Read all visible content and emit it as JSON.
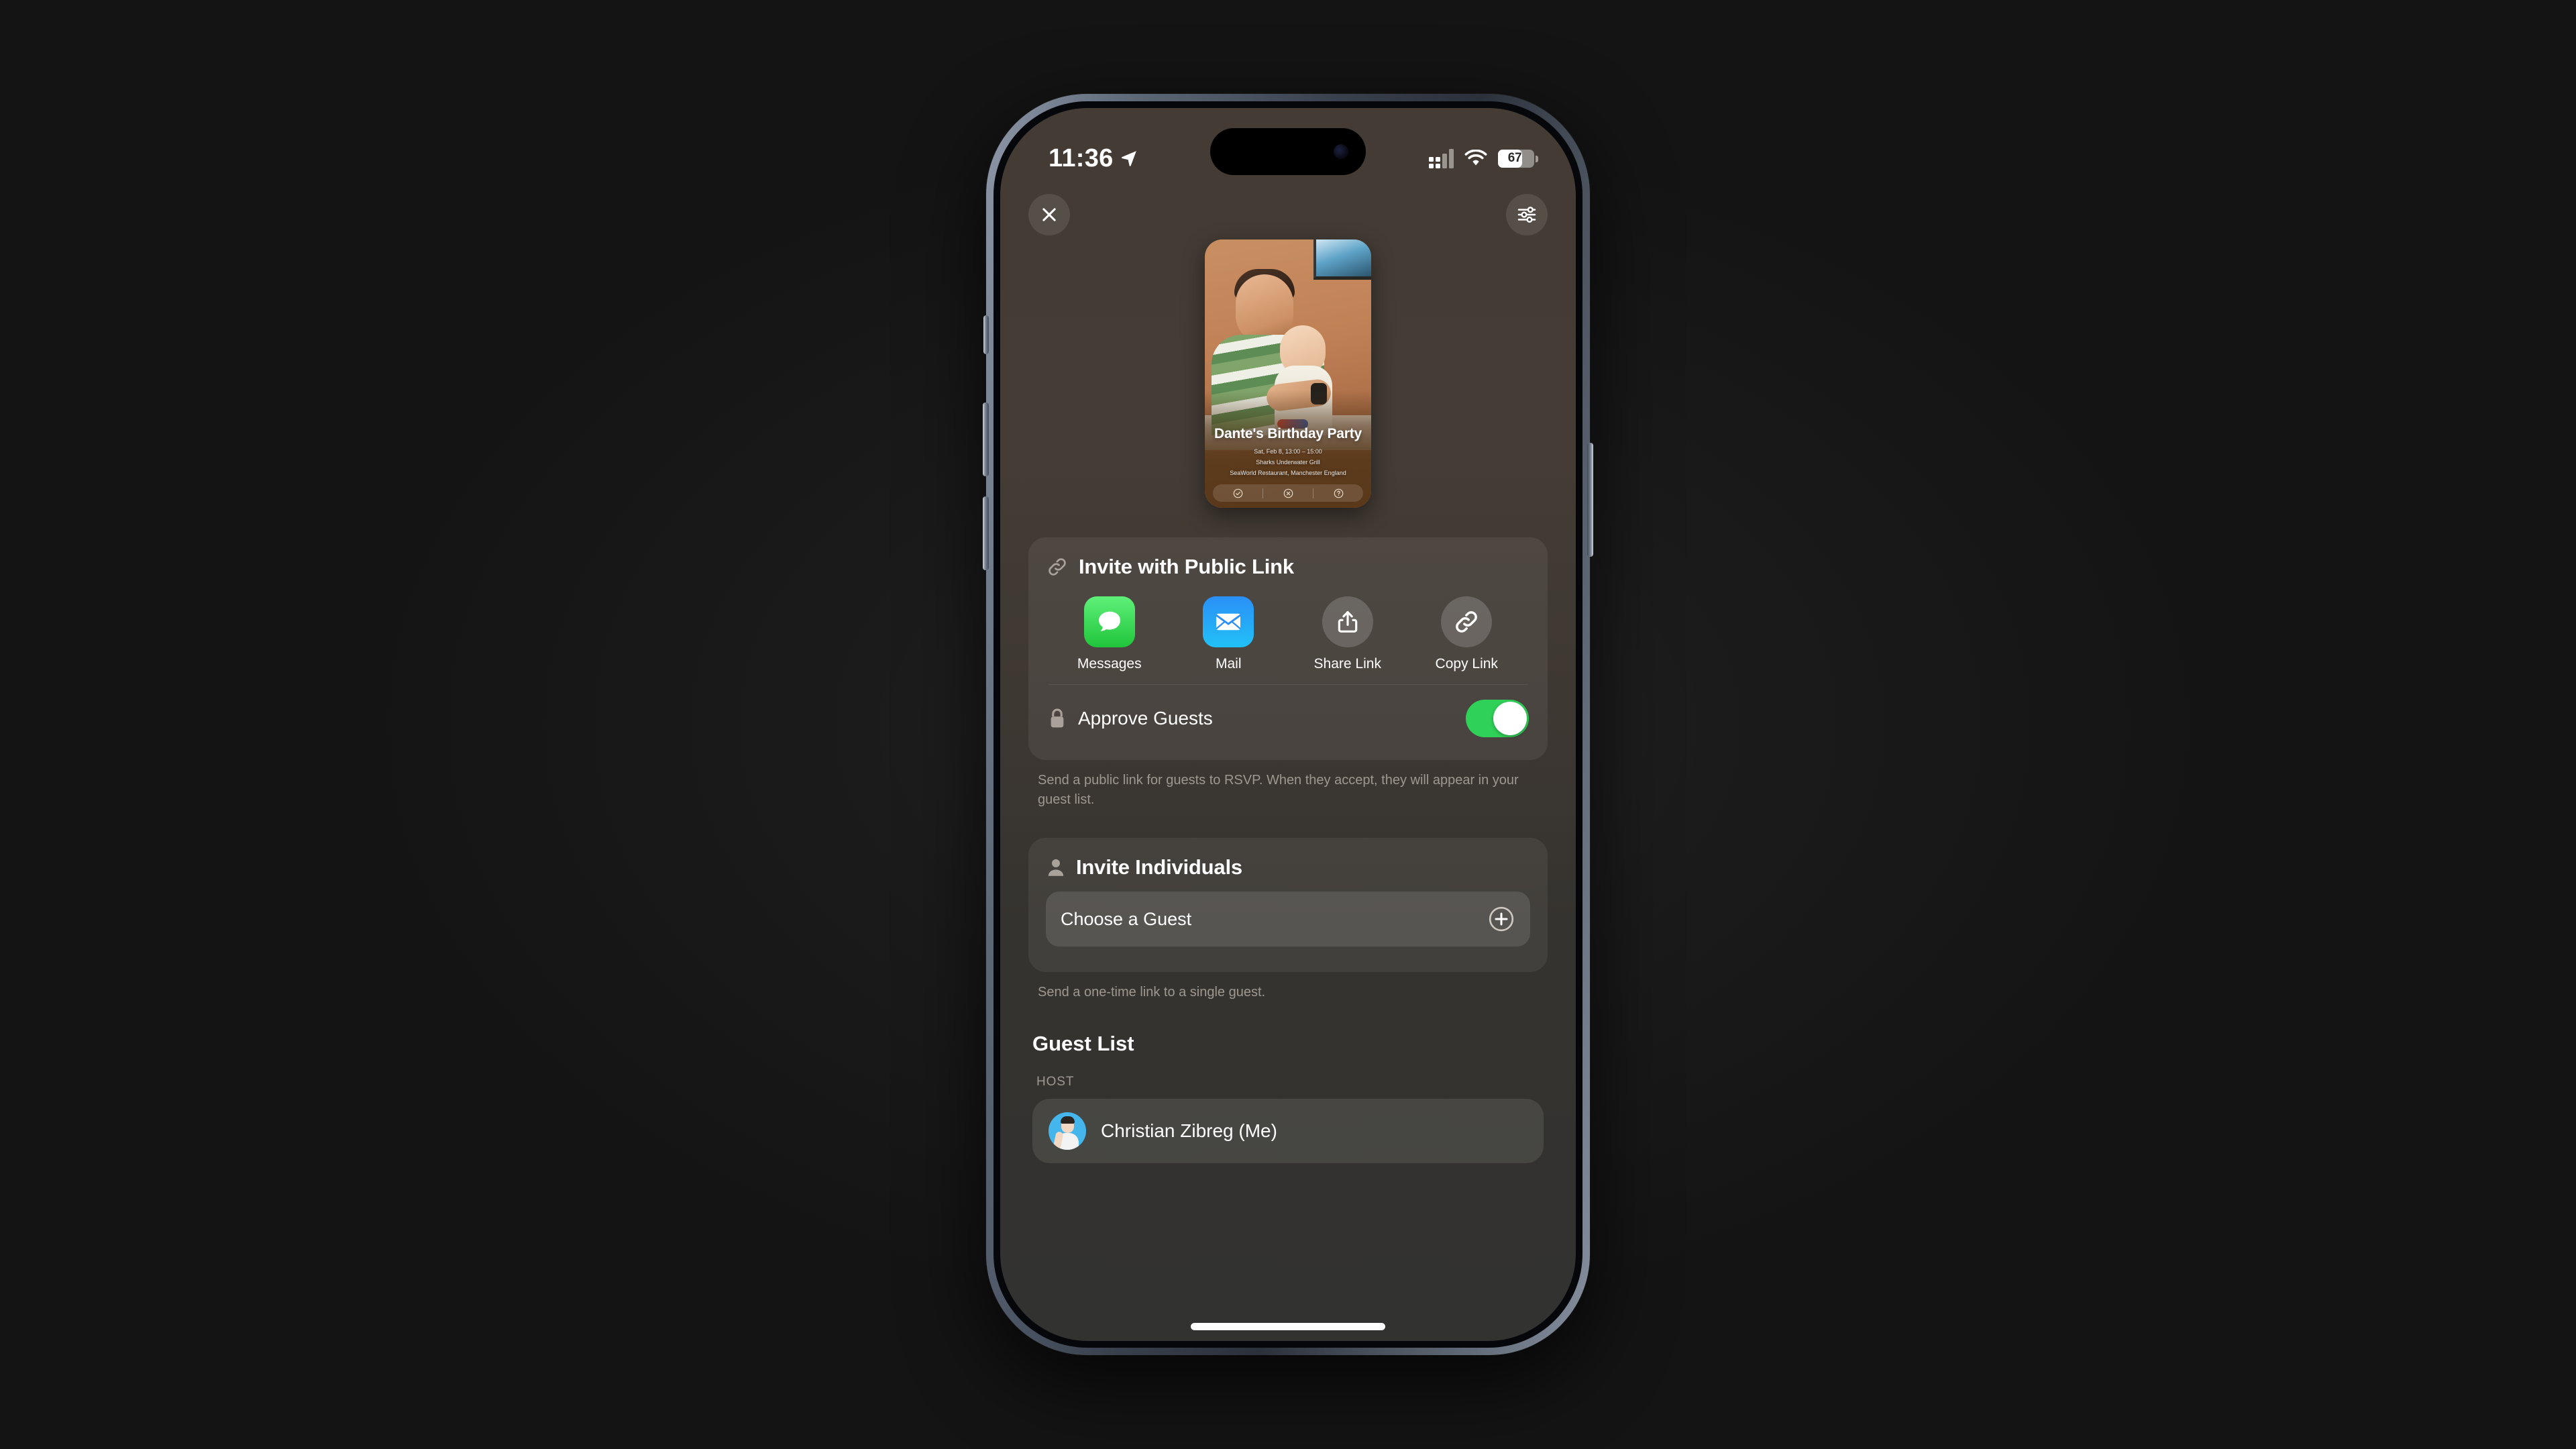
{
  "status_bar": {
    "time": "11:36",
    "location_icon": "location-arrow-icon",
    "cellular_icon": "cellular-signal-icon",
    "wifi_icon": "wifi-icon",
    "battery_percent": "67",
    "battery_level": 67
  },
  "nav": {
    "close_icon": "close-icon",
    "options_icon": "sliders-icon"
  },
  "event_card": {
    "title": "Dante's Birthday Party",
    "date": "Sat, Feb 8, 13:00 – 15:00",
    "venue": "Sharks Underwater Grill",
    "location": "SeaWorld Restaurant, Manchester England",
    "rsvp": {
      "yes_icon": "check-circle-icon",
      "no_icon": "x-circle-icon",
      "maybe_icon": "question-circle-icon"
    }
  },
  "public_link": {
    "icon": "link-icon",
    "title": "Invite with Public Link",
    "actions": [
      {
        "label": "Messages",
        "icon": "messages-icon"
      },
      {
        "label": "Mail",
        "icon": "mail-icon"
      },
      {
        "label": "Share Link",
        "icon": "share-icon"
      },
      {
        "label": "Copy Link",
        "icon": "copy-link-icon"
      }
    ],
    "approve_guests": {
      "icon": "lock-icon",
      "label": "Approve Guests",
      "enabled": true,
      "on_color": "#30d158"
    },
    "caption": "Send a public link for guests to RSVP. When they accept, they will appear in your guest list."
  },
  "invite_individuals": {
    "icon": "person-icon",
    "title": "Invite Individuals",
    "field_label": "Choose a Guest",
    "add_icon": "plus-circle-icon",
    "caption": "Send a one-time link to a single guest."
  },
  "guest_list": {
    "title": "Guest List",
    "host_section_label": "HOST",
    "host": {
      "name": "Christian Zibreg (Me)",
      "avatar_icon": "avatar-icon"
    }
  }
}
